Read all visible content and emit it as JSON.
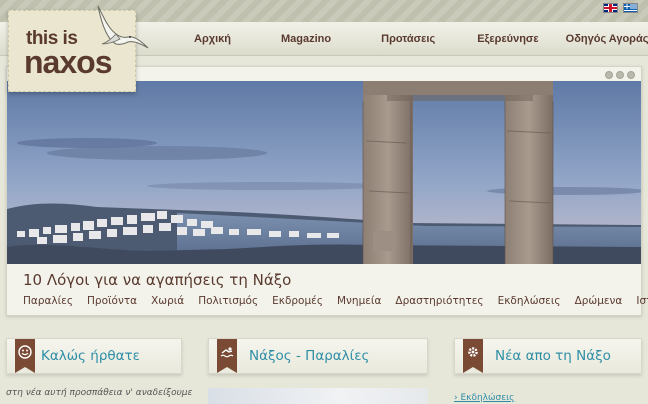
{
  "logo": {
    "line1": "this is",
    "line2": "naxos"
  },
  "nav": [
    {
      "label": "Αρχική"
    },
    {
      "label": "Magazino"
    },
    {
      "label": "Προτάσεις"
    },
    {
      "label": "Εξερεύνησε"
    },
    {
      "label": "Οδηγός Αγοράς"
    }
  ],
  "slider": {
    "caption": "10 Λόγοι για να αγαπήσεις τη Νάξο",
    "categories": [
      "Παραλίες",
      "Προϊόντα",
      "Χωριά",
      "Πολιτισμός",
      "Εκδρομές",
      "Μνημεία",
      "Δραστηριότητες",
      "Εκδηλώσεις",
      "Δρώμενα",
      "Ιστορία"
    ]
  },
  "boxes": {
    "welcome": {
      "title": "Καλώς ήρθατε",
      "text": "στη νέα αυτή προσπάθεια ν' αναδείξουμε"
    },
    "beaches": {
      "title": "Νάξος - Παραλίες"
    },
    "news": {
      "title": "Νέα απο τη Νάξο",
      "link": "› Εκδηλώσεις"
    }
  },
  "colors": {
    "brown": "#5a3a2e",
    "accent": "#2f8ea6",
    "badge": "#7a4a35"
  },
  "icons": [
    "uk-flag-icon",
    "greek-flag-icon",
    "seagull-icon",
    "smiley-icon",
    "swimmer-icon",
    "gear-icon"
  ]
}
